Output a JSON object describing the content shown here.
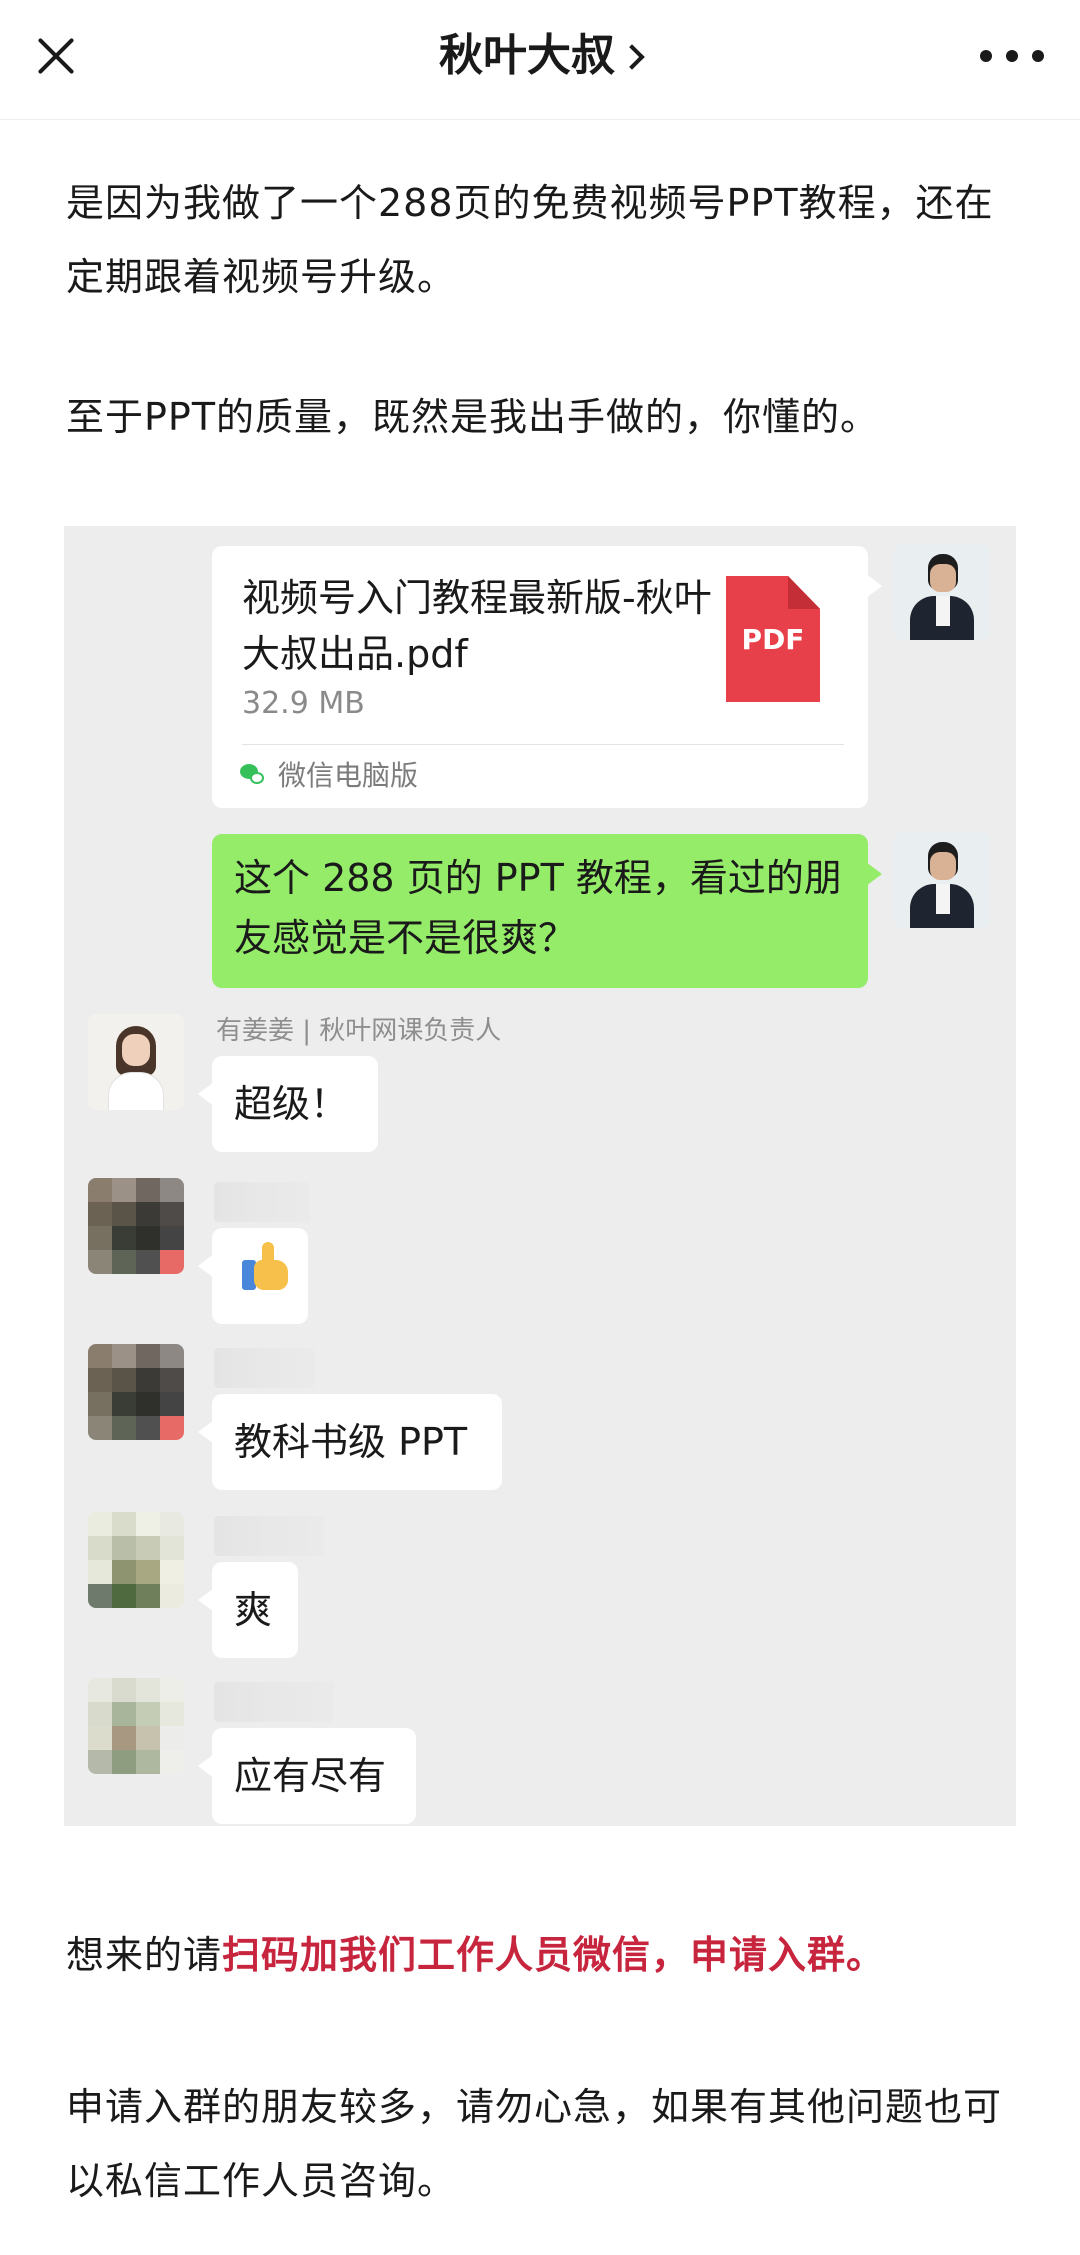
{
  "header": {
    "close_label": "✕",
    "title": "秋叶大叔",
    "more_label": "•••"
  },
  "article": {
    "p1": "是因为我做了一个288页的免费视频号PPT教程，还在定期跟着视频号升级。",
    "p2": "至于PPT的质量，既然是我出手做的，你懂的。",
    "p3_prefix": "想来的请",
    "p3_highlight": "扫码加我们工作人员微信，申请入群。",
    "p4": "申请入群的朋友较多，请勿心急，如果有其他问题也可以私信工作人员咨询。",
    "highlight_color": "#c7253e"
  },
  "chat": {
    "file_message": {
      "file_name": "视频号入门教程最新版-秋叶大叔出品.pdf",
      "file_size": "32.9 MB",
      "file_type_label": "PDF",
      "source": "微信电脑版"
    },
    "my_message": "这个 288 页的 PPT 教程，看过的朋友感觉是不是很爽？",
    "replies": [
      {
        "nickname": "有姜姜 | 秋叶网课负责人",
        "text": "超级！"
      },
      {
        "nickname": "",
        "text": "",
        "icon": "thumbs-up-icon"
      },
      {
        "nickname": "",
        "text": "教科书级 PPT"
      },
      {
        "nickname": "",
        "text": "爽"
      },
      {
        "nickname": "",
        "text": "应有尽有"
      }
    ],
    "colors": {
      "background": "#ededed",
      "my_bubble": "#95ec69",
      "other_bubble": "#ffffff"
    }
  }
}
